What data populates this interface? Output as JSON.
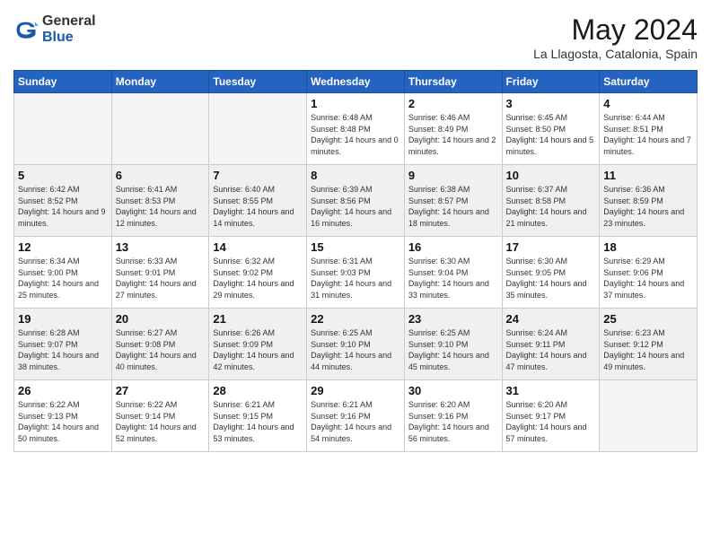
{
  "header": {
    "logo_general": "General",
    "logo_blue": "Blue",
    "month_title": "May 2024",
    "location": "La Llagosta, Catalonia, Spain"
  },
  "weekdays": [
    "Sunday",
    "Monday",
    "Tuesday",
    "Wednesday",
    "Thursday",
    "Friday",
    "Saturday"
  ],
  "weeks": [
    [
      {
        "day": "",
        "empty": true
      },
      {
        "day": "",
        "empty": true
      },
      {
        "day": "",
        "empty": true
      },
      {
        "day": "1",
        "sunrise": "6:48 AM",
        "sunset": "8:48 PM",
        "daylight": "14 hours and 0 minutes."
      },
      {
        "day": "2",
        "sunrise": "6:46 AM",
        "sunset": "8:49 PM",
        "daylight": "14 hours and 2 minutes."
      },
      {
        "day": "3",
        "sunrise": "6:45 AM",
        "sunset": "8:50 PM",
        "daylight": "14 hours and 5 minutes."
      },
      {
        "day": "4",
        "sunrise": "6:44 AM",
        "sunset": "8:51 PM",
        "daylight": "14 hours and 7 minutes."
      }
    ],
    [
      {
        "day": "5",
        "sunrise": "6:42 AM",
        "sunset": "8:52 PM",
        "daylight": "14 hours and 9 minutes."
      },
      {
        "day": "6",
        "sunrise": "6:41 AM",
        "sunset": "8:53 PM",
        "daylight": "14 hours and 12 minutes."
      },
      {
        "day": "7",
        "sunrise": "6:40 AM",
        "sunset": "8:55 PM",
        "daylight": "14 hours and 14 minutes."
      },
      {
        "day": "8",
        "sunrise": "6:39 AM",
        "sunset": "8:56 PM",
        "daylight": "14 hours and 16 minutes."
      },
      {
        "day": "9",
        "sunrise": "6:38 AM",
        "sunset": "8:57 PM",
        "daylight": "14 hours and 18 minutes."
      },
      {
        "day": "10",
        "sunrise": "6:37 AM",
        "sunset": "8:58 PM",
        "daylight": "14 hours and 21 minutes."
      },
      {
        "day": "11",
        "sunrise": "6:36 AM",
        "sunset": "8:59 PM",
        "daylight": "14 hours and 23 minutes."
      }
    ],
    [
      {
        "day": "12",
        "sunrise": "6:34 AM",
        "sunset": "9:00 PM",
        "daylight": "14 hours and 25 minutes."
      },
      {
        "day": "13",
        "sunrise": "6:33 AM",
        "sunset": "9:01 PM",
        "daylight": "14 hours and 27 minutes."
      },
      {
        "day": "14",
        "sunrise": "6:32 AM",
        "sunset": "9:02 PM",
        "daylight": "14 hours and 29 minutes."
      },
      {
        "day": "15",
        "sunrise": "6:31 AM",
        "sunset": "9:03 PM",
        "daylight": "14 hours and 31 minutes."
      },
      {
        "day": "16",
        "sunrise": "6:30 AM",
        "sunset": "9:04 PM",
        "daylight": "14 hours and 33 minutes."
      },
      {
        "day": "17",
        "sunrise": "6:30 AM",
        "sunset": "9:05 PM",
        "daylight": "14 hours and 35 minutes."
      },
      {
        "day": "18",
        "sunrise": "6:29 AM",
        "sunset": "9:06 PM",
        "daylight": "14 hours and 37 minutes."
      }
    ],
    [
      {
        "day": "19",
        "sunrise": "6:28 AM",
        "sunset": "9:07 PM",
        "daylight": "14 hours and 38 minutes."
      },
      {
        "day": "20",
        "sunrise": "6:27 AM",
        "sunset": "9:08 PM",
        "daylight": "14 hours and 40 minutes."
      },
      {
        "day": "21",
        "sunrise": "6:26 AM",
        "sunset": "9:09 PM",
        "daylight": "14 hours and 42 minutes."
      },
      {
        "day": "22",
        "sunrise": "6:25 AM",
        "sunset": "9:10 PM",
        "daylight": "14 hours and 44 minutes."
      },
      {
        "day": "23",
        "sunrise": "6:25 AM",
        "sunset": "9:10 PM",
        "daylight": "14 hours and 45 minutes."
      },
      {
        "day": "24",
        "sunrise": "6:24 AM",
        "sunset": "9:11 PM",
        "daylight": "14 hours and 47 minutes."
      },
      {
        "day": "25",
        "sunrise": "6:23 AM",
        "sunset": "9:12 PM",
        "daylight": "14 hours and 49 minutes."
      }
    ],
    [
      {
        "day": "26",
        "sunrise": "6:22 AM",
        "sunset": "9:13 PM",
        "daylight": "14 hours and 50 minutes."
      },
      {
        "day": "27",
        "sunrise": "6:22 AM",
        "sunset": "9:14 PM",
        "daylight": "14 hours and 52 minutes."
      },
      {
        "day": "28",
        "sunrise": "6:21 AM",
        "sunset": "9:15 PM",
        "daylight": "14 hours and 53 minutes."
      },
      {
        "day": "29",
        "sunrise": "6:21 AM",
        "sunset": "9:16 PM",
        "daylight": "14 hours and 54 minutes."
      },
      {
        "day": "30",
        "sunrise": "6:20 AM",
        "sunset": "9:16 PM",
        "daylight": "14 hours and 56 minutes."
      },
      {
        "day": "31",
        "sunrise": "6:20 AM",
        "sunset": "9:17 PM",
        "daylight": "14 hours and 57 minutes."
      },
      {
        "day": "",
        "empty": true
      }
    ]
  ]
}
